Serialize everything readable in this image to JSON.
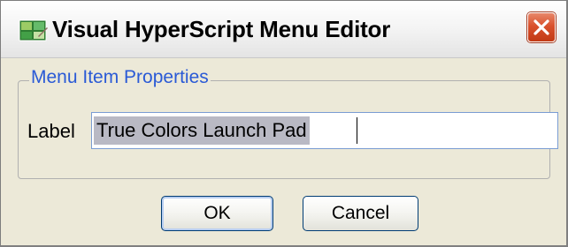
{
  "window": {
    "title": "Visual HyperScript Menu Editor",
    "app_icon": "app-icon",
    "close_icon": "close-icon",
    "colors": {
      "dialog_background": "#ece9d8",
      "legend_text": "#2a5ad6",
      "close_button": "#d9512d",
      "selection_highlight": "#b9b9c4"
    }
  },
  "group": {
    "legend": "Menu Item Properties"
  },
  "fields": {
    "label": {
      "label": "Label",
      "value": "True Colors Launch Pad",
      "selected": true
    }
  },
  "buttons": {
    "ok_label": "OK",
    "cancel_label": "Cancel"
  }
}
